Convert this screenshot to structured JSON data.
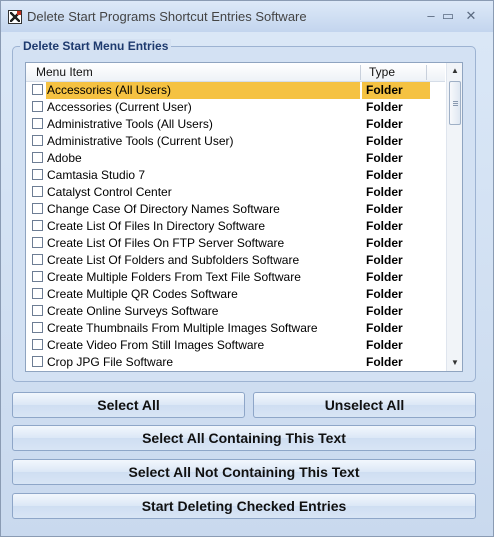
{
  "window": {
    "title": "Delete Start Programs Shortcut Entries Software",
    "controls": {
      "minimize": "–",
      "maximize": "▭",
      "close": "✕"
    }
  },
  "group": {
    "label": "Delete Start Menu Entries"
  },
  "list": {
    "columns": [
      "Menu Item",
      "Type"
    ],
    "selected_index": 0,
    "rows": [
      {
        "name": "Accessories (All Users)",
        "type": "Folder",
        "checked": false
      },
      {
        "name": "Accessories (Current User)",
        "type": "Folder",
        "checked": false
      },
      {
        "name": "Administrative Tools (All Users)",
        "type": "Folder",
        "checked": false
      },
      {
        "name": "Administrative Tools (Current User)",
        "type": "Folder",
        "checked": false
      },
      {
        "name": "Adobe",
        "type": "Folder",
        "checked": false
      },
      {
        "name": "Camtasia Studio 7",
        "type": "Folder",
        "checked": false
      },
      {
        "name": "Catalyst Control Center",
        "type": "Folder",
        "checked": false
      },
      {
        "name": "Change Case Of Directory Names Software",
        "type": "Folder",
        "checked": false
      },
      {
        "name": "Create List Of Files In Directory Software",
        "type": "Folder",
        "checked": false
      },
      {
        "name": "Create List Of Files On FTP Server Software",
        "type": "Folder",
        "checked": false
      },
      {
        "name": "Create List Of Folders and Subfolders Software",
        "type": "Folder",
        "checked": false
      },
      {
        "name": "Create Multiple Folders From Text File Software",
        "type": "Folder",
        "checked": false
      },
      {
        "name": "Create Multiple QR Codes Software",
        "type": "Folder",
        "checked": false
      },
      {
        "name": "Create Online Surveys Software",
        "type": "Folder",
        "checked": false
      },
      {
        "name": "Create Thumbnails From Multiple Images Software",
        "type": "Folder",
        "checked": false
      },
      {
        "name": "Create Video From Still Images Software",
        "type": "Folder",
        "checked": false
      },
      {
        "name": "Crop JPG File Software",
        "type": "Folder",
        "checked": false
      }
    ]
  },
  "buttons": {
    "select_all": "Select All",
    "unselect_all": "Unselect All",
    "select_containing": "Select All Containing This Text",
    "select_not_containing": "Select All Not Containing This Text",
    "start_deleting": "Start Deleting Checked Entries"
  },
  "colors": {
    "selection": "#f5c242",
    "group_label": "#1e3a6e"
  }
}
